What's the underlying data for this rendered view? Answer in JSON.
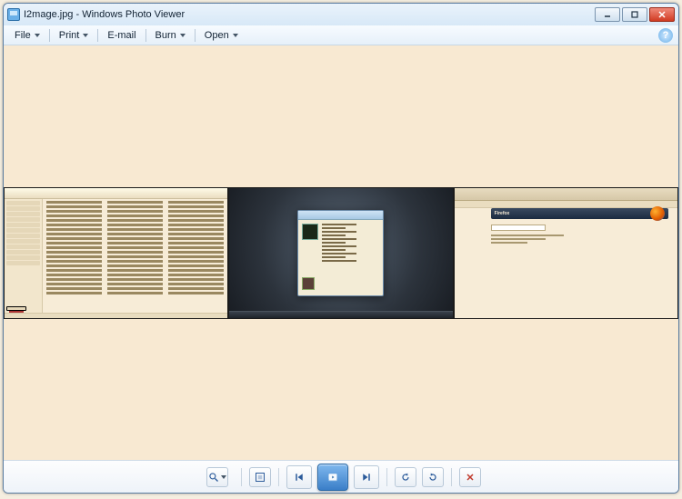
{
  "window": {
    "title": "I2mage.jpg - Windows Photo Viewer"
  },
  "menu": {
    "file": "File",
    "print": "Print",
    "email": "E-mail",
    "burn": "Burn",
    "open": "Open"
  },
  "panels": {
    "firefox_label": "Firefox"
  },
  "controls": {
    "zoom_out": "−",
    "zoom_in": "+",
    "fit": "⊡",
    "prev": "◀",
    "play": "▶",
    "next": "▶",
    "rotate_ccw": "↶",
    "rotate_cw": "↷",
    "delete": "✕",
    "help": "?"
  }
}
